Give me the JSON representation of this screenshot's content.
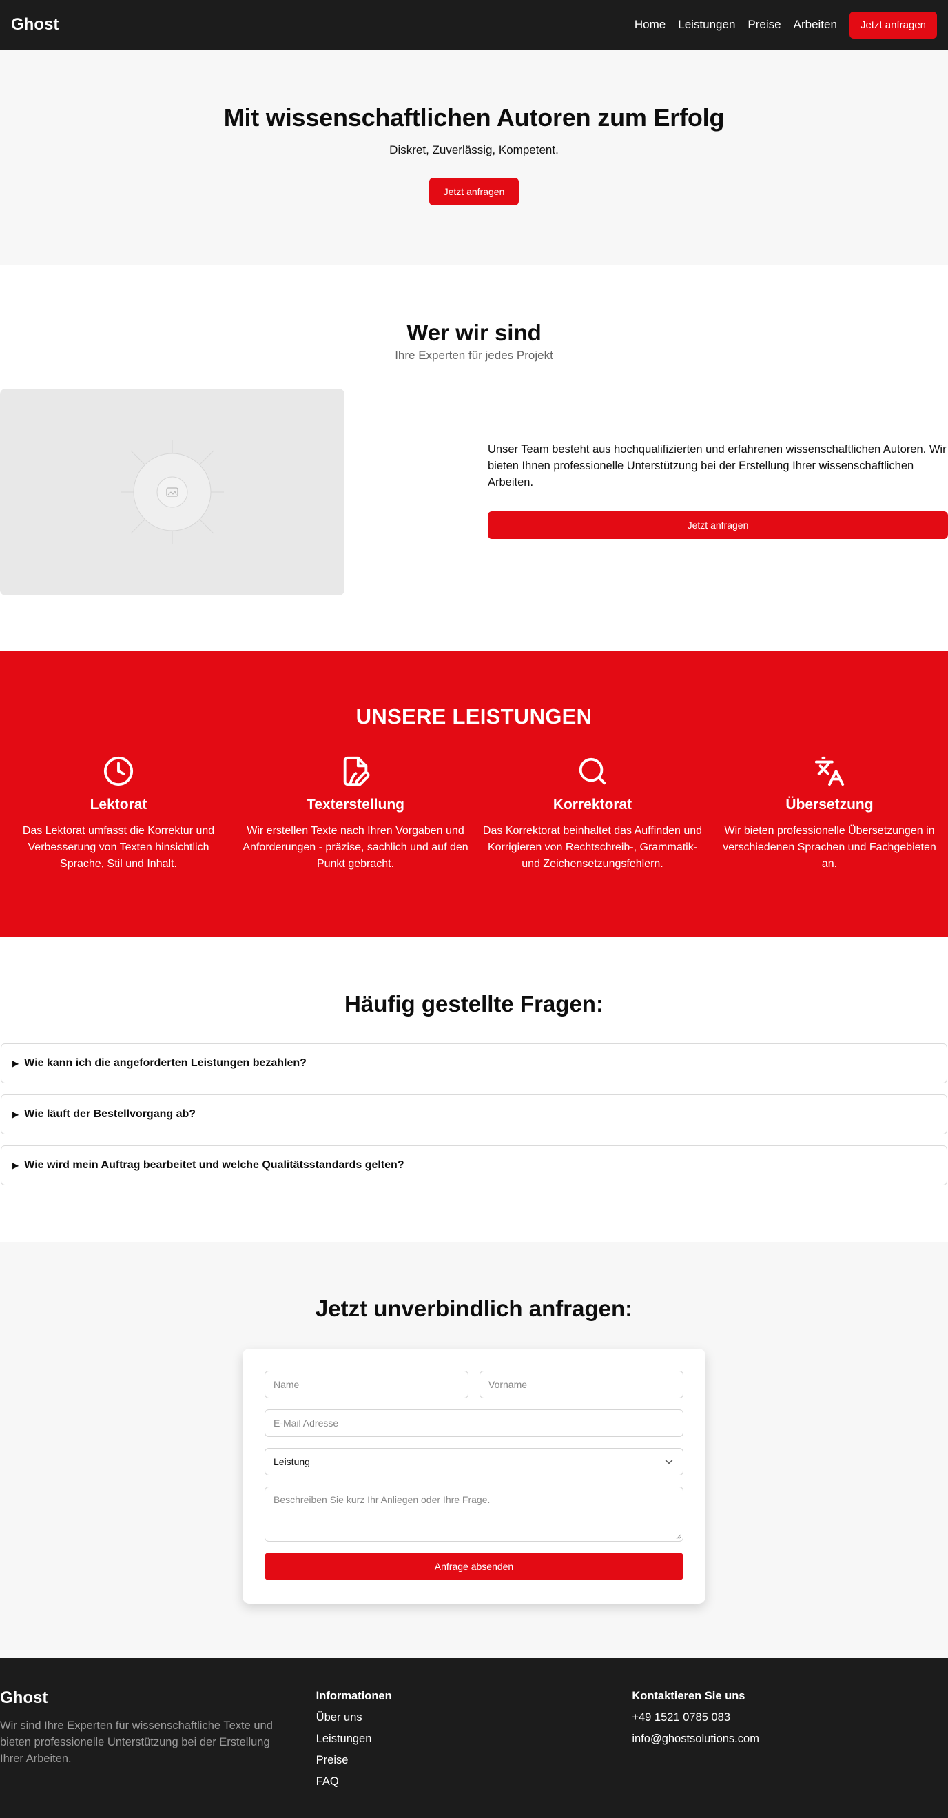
{
  "nav": {
    "brand": "Ghost",
    "links": [
      "Home",
      "Leistungen",
      "Preise",
      "Arbeiten"
    ],
    "cta": "Jetzt anfragen"
  },
  "hero": {
    "title": "Mit wissenschaftlichen Autoren zum Erfolg",
    "subtitle": "Diskret, Zuverlässig, Kompetent.",
    "cta": "Jetzt anfragen"
  },
  "about": {
    "title": "Wer wir sind",
    "subtitle": "Ihre Experten für jedes Projekt",
    "text": "Unser Team besteht aus hochqualifizierten und erfahrenen wissenschaftlichen Autoren. Wir bieten Ihnen professionelle Unterstützung bei der Erstellung Ihrer wissenschaftlichen Arbeiten.",
    "cta": "Jetzt anfragen",
    "image_icon": "image-placeholder-icon"
  },
  "services": {
    "title": "UNSERE LEISTUNGEN",
    "items": [
      {
        "icon": "clock-icon",
        "title": "Lektorat",
        "text": "Das Lektorat umfasst die Korrektur und Verbesserung von Texten hinsichtlich Sprache, Stil und Inhalt."
      },
      {
        "icon": "file-pen-icon",
        "title": "Texterstellung",
        "text": "Wir erstellen Texte nach Ihren Vorgaben und Anforderungen - präzise, sachlich und auf den Punkt gebracht."
      },
      {
        "icon": "search-icon",
        "title": "Korrektorat",
        "text": "Das Korrektorat beinhaltet das Auffinden und Korrigieren von Rechtschreib-, Grammatik- und Zeichensetzungsfehlern."
      },
      {
        "icon": "translate-icon",
        "title": "Übersetzung",
        "text": "Wir bieten professionelle Übersetzungen in verschiedenen Sprachen und Fachgebieten an."
      }
    ]
  },
  "faq": {
    "title": "Häufig gestellte Fragen:",
    "items": [
      "Wie kann ich die angeforderten Leistungen bezahlen?",
      "Wie läuft der Bestellvorgang ab?",
      "Wie wird mein Auftrag bearbeitet und welche Qualitätsstandards gelten?"
    ]
  },
  "contact": {
    "title": "Jetzt unverbindlich anfragen:",
    "name_placeholder": "Name",
    "vorname_placeholder": "Vorname",
    "email_placeholder": "E-Mail Adresse",
    "service_value": "Leistung",
    "message_placeholder": "Beschreiben Sie kurz Ihr Anliegen oder Ihre Frage.",
    "submit": "Anfrage absenden"
  },
  "footer": {
    "brand": "Ghost",
    "description": "Wir sind Ihre Experten für wissenschaftliche Texte und bieten professionelle Unterstützung bei der Erstellung Ihrer Arbeiten.",
    "info_heading": "Informationen",
    "info_links": [
      "Über uns",
      "Leistungen",
      "Preise",
      "FAQ"
    ],
    "contact_heading": "Kontaktieren Sie uns",
    "phone": "+49 1521 0785 083",
    "email": "info@ghostsolutions.com"
  },
  "colors": {
    "accent": "#e30b14",
    "dark": "#1c1c1c",
    "light_bg": "#f7f7f7"
  }
}
